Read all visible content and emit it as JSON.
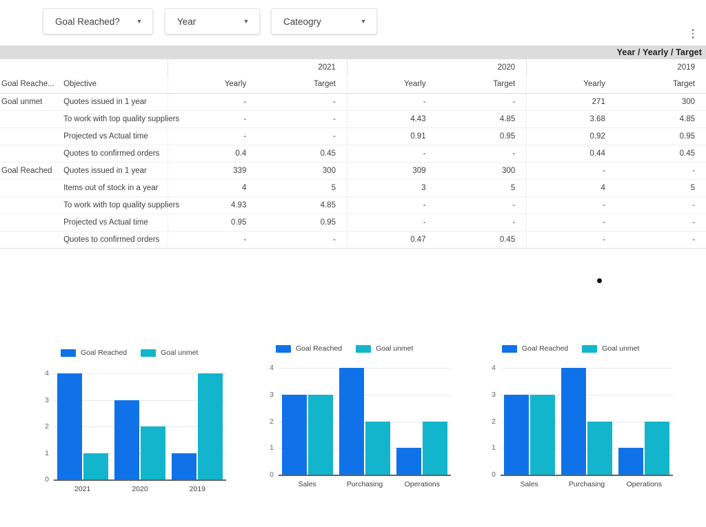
{
  "filters": [
    {
      "id": "goal-reached",
      "label": "Goal Reached?",
      "caret": "chevron-down-icon"
    },
    {
      "id": "year",
      "label": "Year",
      "caret": "chevron-down-icon"
    },
    {
      "id": "cateogry",
      "label": "Cateogry",
      "caret": "chevron-down-icon"
    }
  ],
  "overflow_menu": {
    "icon": "more-vert-icon"
  },
  "table": {
    "band_title": "Year / Yearly / Target",
    "row_headers": [
      "Goal Reache...",
      "Objective"
    ],
    "year_groups": [
      {
        "year": "2021",
        "measures": [
          "Yearly",
          "Target"
        ]
      },
      {
        "year": "2020",
        "measures": [
          "Yearly",
          "Target"
        ]
      },
      {
        "year": "2019",
        "measures": [
          "Yearly",
          "Target"
        ]
      }
    ],
    "rows": [
      {
        "goal": "Goal unmet",
        "objective": "Quotes issued in 1 year",
        "values": [
          "-",
          "-",
          "-",
          "-",
          "271",
          "300"
        ]
      },
      {
        "goal": "",
        "objective": "To work with top quality suppliers",
        "values": [
          "-",
          "-",
          "4.43",
          "4.85",
          "3.68",
          "4.85"
        ]
      },
      {
        "goal": "",
        "objective": "Projected vs Actual time",
        "values": [
          "-",
          "-",
          "0.91",
          "0.95",
          "0.92",
          "0.95"
        ]
      },
      {
        "goal": "",
        "objective": "Quotes to confirmed orders",
        "values": [
          "0.4",
          "0.45",
          "-",
          "-",
          "0.44",
          "0.45"
        ]
      },
      {
        "goal": "Goal Reached",
        "objective": "Quotes issued in 1 year",
        "values": [
          "339",
          "300",
          "309",
          "300",
          "-",
          "-"
        ]
      },
      {
        "goal": "",
        "objective": "Items out of stock in a year",
        "values": [
          "4",
          "5",
          "3",
          "5",
          "4",
          "5"
        ]
      },
      {
        "goal": "",
        "objective": "To work with top quality suppliers",
        "values": [
          "4.93",
          "4.85",
          "-",
          "-",
          "-",
          "-"
        ]
      },
      {
        "goal": "",
        "objective": "Projected vs Actual time",
        "values": [
          "0.95",
          "0.95",
          "-",
          "-",
          "-",
          "-"
        ]
      },
      {
        "goal": "",
        "objective": "Quotes to confirmed orders",
        "values": [
          "-",
          "-",
          "0.47",
          "0.45",
          "-",
          "-"
        ]
      }
    ]
  },
  "colors": {
    "series_goal_reached": "#1072e8",
    "series_goal_unmet": "#12b5cb",
    "grid": "#e8e8e8",
    "axis": "#5f6368",
    "band": "#dcdcdc"
  },
  "chart_data": [
    {
      "id": "chart-by-year",
      "type": "bar",
      "title": "",
      "xlabel": "",
      "ylabel": "",
      "categories": [
        "2021",
        "2020",
        "2019"
      ],
      "series": [
        {
          "name": "Goal Reached",
          "values": [
            4,
            3,
            1
          ],
          "color": "#1072e8"
        },
        {
          "name": "Goal unmet",
          "values": [
            1,
            2,
            4
          ],
          "color": "#12b5cb"
        }
      ],
      "yticks": [
        0,
        1,
        2,
        3,
        4
      ],
      "ylim": [
        0,
        4
      ],
      "grid": true,
      "legend_position": "top"
    },
    {
      "id": "chart-by-category-a",
      "type": "bar",
      "title": "",
      "xlabel": "",
      "ylabel": "",
      "categories": [
        "Sales",
        "Purchasing",
        "Operations"
      ],
      "series": [
        {
          "name": "Goal Reached",
          "values": [
            3,
            4,
            1
          ],
          "color": "#1072e8"
        },
        {
          "name": "Goal unmet",
          "values": [
            3,
            2,
            2
          ],
          "color": "#12b5cb"
        }
      ],
      "yticks": [
        0,
        1,
        2,
        3,
        4
      ],
      "ylim": [
        0,
        4
      ],
      "grid": true,
      "legend_position": "top"
    },
    {
      "id": "chart-by-category-b",
      "type": "bar",
      "title": "",
      "xlabel": "",
      "ylabel": "",
      "categories": [
        "Sales",
        "Purchasing",
        "Operations"
      ],
      "series": [
        {
          "name": "Goal Reached",
          "values": [
            3,
            4,
            1
          ],
          "color": "#1072e8"
        },
        {
          "name": "Goal unmet",
          "values": [
            3,
            2,
            2
          ],
          "color": "#12b5cb"
        }
      ],
      "yticks": [
        0,
        1,
        2,
        3,
        4
      ],
      "ylim": [
        0,
        4
      ],
      "grid": true,
      "legend_position": "top"
    }
  ]
}
